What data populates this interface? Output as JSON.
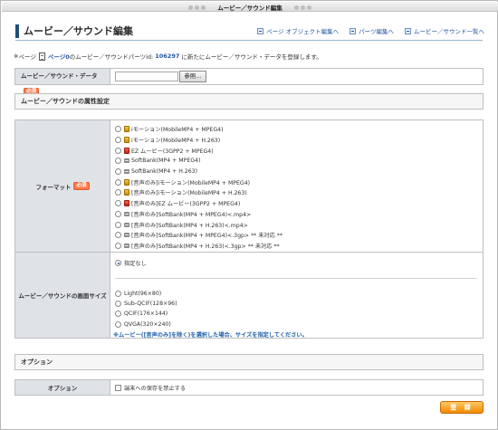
{
  "window": {
    "title": "ムービー／サウンド編集"
  },
  "page": {
    "title": "ムービー／サウンド編集"
  },
  "toplinks": [
    {
      "label": "ページ オブジェクト編集へ"
    },
    {
      "label": "パーツ編集へ"
    },
    {
      "label": "ムービー／サウンド一覧へ"
    }
  ],
  "notice": {
    "prefix": "ページ",
    "link": "ページ0",
    "middle": "のムービー／サウンドパーツid:",
    "id": "106297",
    "suffix": "に新たにムービー／サウンド・データを登録します。"
  },
  "file": {
    "label": "ムービー／サウンド・データ",
    "required": "必須",
    "browse_label": "参照..."
  },
  "attr_section": {
    "title": "ムービー／サウンドの属性設定"
  },
  "format": {
    "label": "フォーマット",
    "required": "必須",
    "options": [
      {
        "icon": "docomo-icon",
        "label": "iモーション(MobileMP4 + MPEG4)"
      },
      {
        "icon": "docomo-icon",
        "label": "iモーション(MobileMP4 + H.263)"
      },
      {
        "icon": "au-icon",
        "label": "EZ ムービー(3GPP2 + MPEG4)"
      },
      {
        "icon": "softbank-icon",
        "label": "SoftBank(MP4 + MPEG4)"
      },
      {
        "icon": "softbank-icon",
        "label": "SoftBank(MP4 + H.263)"
      },
      {
        "icon": "docomo-icon",
        "label": "[音声のみ]iモーション(MobileMP4 + MPEG4)"
      },
      {
        "icon": "docomo-icon",
        "label": "[音声のみ]iモーション(MobileMP4 + H.263)"
      },
      {
        "icon": "au-icon",
        "label": "[音声のみ]EZ ムービー(3GPP2 + MPEG4)"
      },
      {
        "icon": "softbank-icon",
        "label": "[音声のみ]SoftBank(MP4 + MPEG4)<.mp4>"
      },
      {
        "icon": "softbank-icon",
        "label": "[音声のみ]SoftBank(MP4 + H.263)<.mp4>"
      },
      {
        "icon": "softbank-icon",
        "label": "[音声のみ]SoftBank(MP4 + MPEG4)<.3gp> ** 未対応 **"
      },
      {
        "icon": "softbank-icon",
        "label": "[音声のみ]SoftBank(MP4 + H.263)<.3gp> ** 未対応 **"
      }
    ]
  },
  "screen_size": {
    "label": "ムービー／サウンドの画面サイズ",
    "default_option": "指定なし",
    "options": [
      "Light(96×80)",
      "Sub-QCIF(128×96)",
      "QCIF(176×144)",
      "QVGA(320×240)"
    ],
    "note": "※ムービー([音声のみ]を除く)を選択した場合、サイズを指定してください。"
  },
  "option_section": {
    "title": "オプション"
  },
  "option": {
    "label": "オプション",
    "checkbox_label": "端末への保存を禁止する"
  },
  "submit": {
    "label": "登 録"
  }
}
